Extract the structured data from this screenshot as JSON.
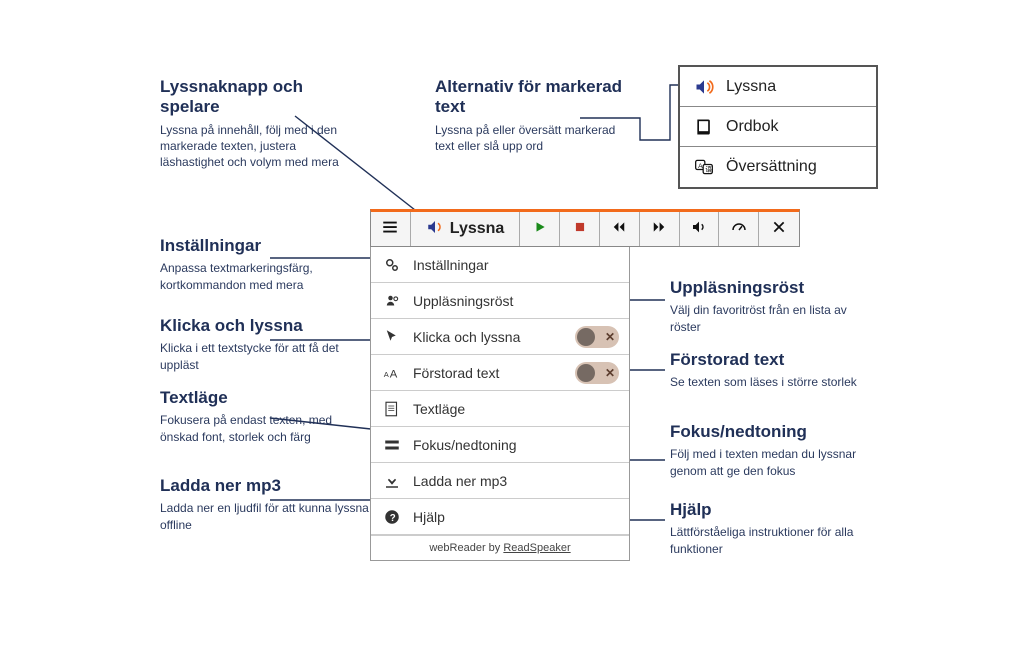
{
  "annotations": {
    "player": {
      "title": "Lyssnaknapp och spelare",
      "desc": "Lyssna på innehåll, följ med i den markerade texten, justera läshastighet och volym med mera"
    },
    "settings": {
      "title": "Inställningar",
      "desc": "Anpassa textmarkeringsfärg, kortkommandon med mera"
    },
    "clicklisten": {
      "title": "Klicka och lyssna",
      "desc": "Klicka i ett textstycke för att få det uppläst"
    },
    "textmode": {
      "title": "Textläge",
      "desc": "Fokusera på endast texten, med önskad font, storlek och färg"
    },
    "download": {
      "title": "Ladda ner mp3",
      "desc": "Ladda ner en ljudfil för att kunna lyssna offline"
    },
    "selection": {
      "title": "Alternativ för markerad text",
      "desc": "Lyssna på eller översätt markerad text eller slå upp ord"
    },
    "voice": {
      "title": "Uppläsningsröst",
      "desc": "Välj din favoritröst från en lista av röster"
    },
    "enlarge": {
      "title": "Förstorad text",
      "desc": "Se texten som läses i större storlek"
    },
    "focus": {
      "title": "Fokus/nedtoning",
      "desc": "Följ med i texten medan du lyssnar genom att ge den fokus"
    },
    "help": {
      "title": "Hjälp",
      "desc": "Lättförståeliga instruktioner för alla funktioner"
    }
  },
  "player": {
    "listen_label": "Lyssna"
  },
  "dropdown": {
    "settings": "Inställningar",
    "voice": "Uppläsningsröst",
    "clicklisten": "Klicka och lyssna",
    "enlarge": "Förstorad text",
    "textmode": "Textläge",
    "focus": "Fokus/nedtoning",
    "download": "Ladda ner mp3",
    "help": "Hjälp",
    "footer_prefix": "webReader by ",
    "footer_link": "ReadSpeaker"
  },
  "context": {
    "listen": "Lyssna",
    "dictionary": "Ordbok",
    "translate": "Översättning"
  }
}
